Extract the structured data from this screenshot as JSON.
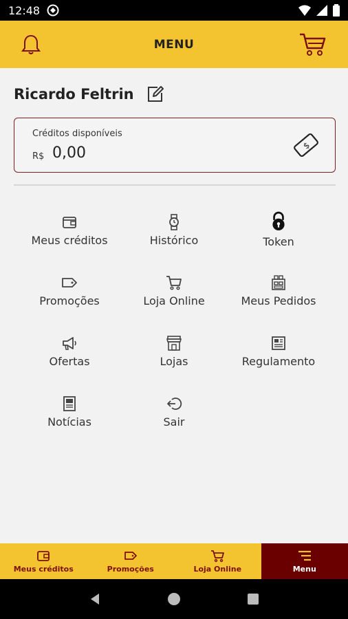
{
  "status_bar": {
    "time": "12:48"
  },
  "app_bar": {
    "title": "MENU",
    "icons": {
      "left": "bell-icon",
      "right": "cart-icon"
    }
  },
  "user": {
    "name": "Ricardo Feltrin"
  },
  "credits": {
    "label": "Créditos disponíveis",
    "currency": "R$",
    "amount": "0,00",
    "icon": "money-bill-icon"
  },
  "menu": {
    "items": [
      {
        "label": "Meus créditos",
        "icon": "wallet-icon"
      },
      {
        "label": "Histórico",
        "icon": "watch-icon"
      },
      {
        "label": "Token",
        "icon": "lock-icon"
      },
      {
        "label": "Promoções",
        "icon": "tag-icon"
      },
      {
        "label": "Loja Online",
        "icon": "cart-icon"
      },
      {
        "label": "Meus Pedidos",
        "icon": "orders-icon"
      },
      {
        "label": "Ofertas",
        "icon": "megaphone-icon"
      },
      {
        "label": "Lojas",
        "icon": "store-icon"
      },
      {
        "label": "Regulamento",
        "icon": "document-icon"
      },
      {
        "label": "Notícias",
        "icon": "news-icon"
      },
      {
        "label": "Sair",
        "icon": "logout-icon"
      }
    ]
  },
  "bottom_nav": {
    "items": [
      {
        "label": "Meus créditos",
        "icon": "wallet-icon"
      },
      {
        "label": "Promoções",
        "icon": "tag-icon"
      },
      {
        "label": "Loja Online",
        "icon": "cart-icon"
      },
      {
        "label": "Menu",
        "icon": "menu-icon"
      }
    ],
    "active": "Menu"
  },
  "colors": {
    "accent": "#f4c430",
    "brand_dark": "#6b0000",
    "border": "#7a1f1f"
  }
}
